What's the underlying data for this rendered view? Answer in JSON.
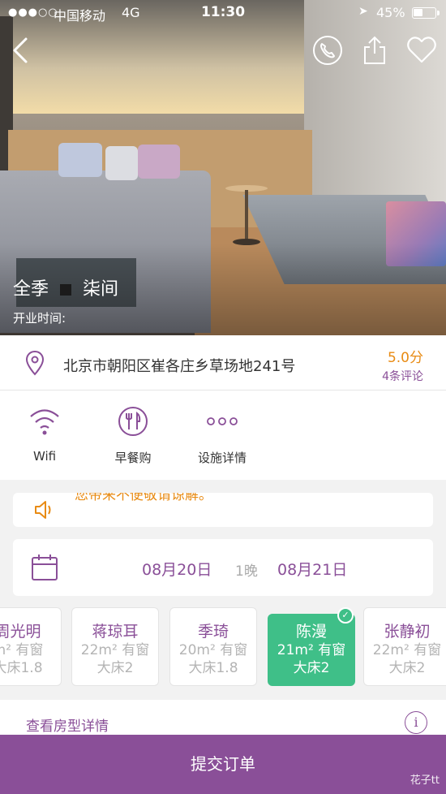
{
  "status_bar": {
    "signal_dots": "●●●○○",
    "carrier": "中国移动",
    "network": "4G",
    "time": "11:30",
    "battery_percent": "45%",
    "battery_level": 0.45
  },
  "header_icons": [
    "back-icon",
    "phone-icon",
    "share-icon",
    "heart-icon"
  ],
  "hotel": {
    "name_part1": "全季",
    "name_part2": "柒间",
    "open_time_label": "开业时间:",
    "address": "北京市朝阳区崔各庄乡草场地241号",
    "score": "5.0分",
    "reviews": "4条评论"
  },
  "facilities": [
    {
      "label": "Wifi",
      "icon": "wifi-icon"
    },
    {
      "label": "早餐购",
      "icon": "fork-knife-icon"
    },
    {
      "label": "设施详情",
      "icon": "more-dots-icon"
    }
  ],
  "notice": {
    "text": "您带来不便敬请谅解。",
    "icon": "speaker-icon"
  },
  "dates": {
    "check_in": "08月20日",
    "nights": "1晚",
    "check_out": "08月21日"
  },
  "rooms": [
    {
      "name": "周光明",
      "size": "m² 有窗",
      "bed": "大床1.8"
    },
    {
      "name": "蒋琼耳",
      "size": "22m² 有窗",
      "bed": "大床2"
    },
    {
      "name": "季琦",
      "size": "20m² 有窗",
      "bed": "大床1.8"
    },
    {
      "name": "陈漫",
      "size": "21m² 有窗",
      "bed": "大床2",
      "selected": true
    },
    {
      "name": "张静初",
      "size": "22m² 有窗",
      "bed": "大床2"
    }
  ],
  "detail_link": "查看房型详情",
  "submit_label": "提交订单",
  "watermark": "花子tt",
  "colors": {
    "accent": "#8a4f98",
    "orange": "#e88b14",
    "selected_green": "#3fbf88"
  }
}
